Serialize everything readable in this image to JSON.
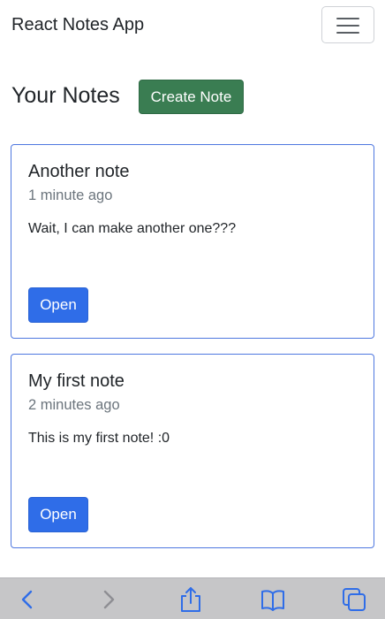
{
  "navbar": {
    "brand": "React Notes App",
    "menu_icon": "hamburger-menu-icon"
  },
  "page": {
    "title": "Your Notes",
    "create_label": "Create Note"
  },
  "notes": [
    {
      "title": "Another note",
      "time": "1 minute ago",
      "body": "Wait, I can make another one???",
      "open_label": "Open"
    },
    {
      "title": "My first note",
      "time": "2 minutes ago",
      "body": "This is my first note! :0",
      "open_label": "Open"
    }
  ],
  "browser_toolbar": {
    "icons": [
      "back-icon",
      "forward-icon",
      "share-icon",
      "bookmarks-icon",
      "tabs-icon"
    ]
  },
  "colors": {
    "create_button": "#3a7d52",
    "open_button": "#2f6de8",
    "card_border": "#4f78e0",
    "toolbar_bg": "#c6c6c8",
    "toolbar_icon": "#2f6de8"
  }
}
